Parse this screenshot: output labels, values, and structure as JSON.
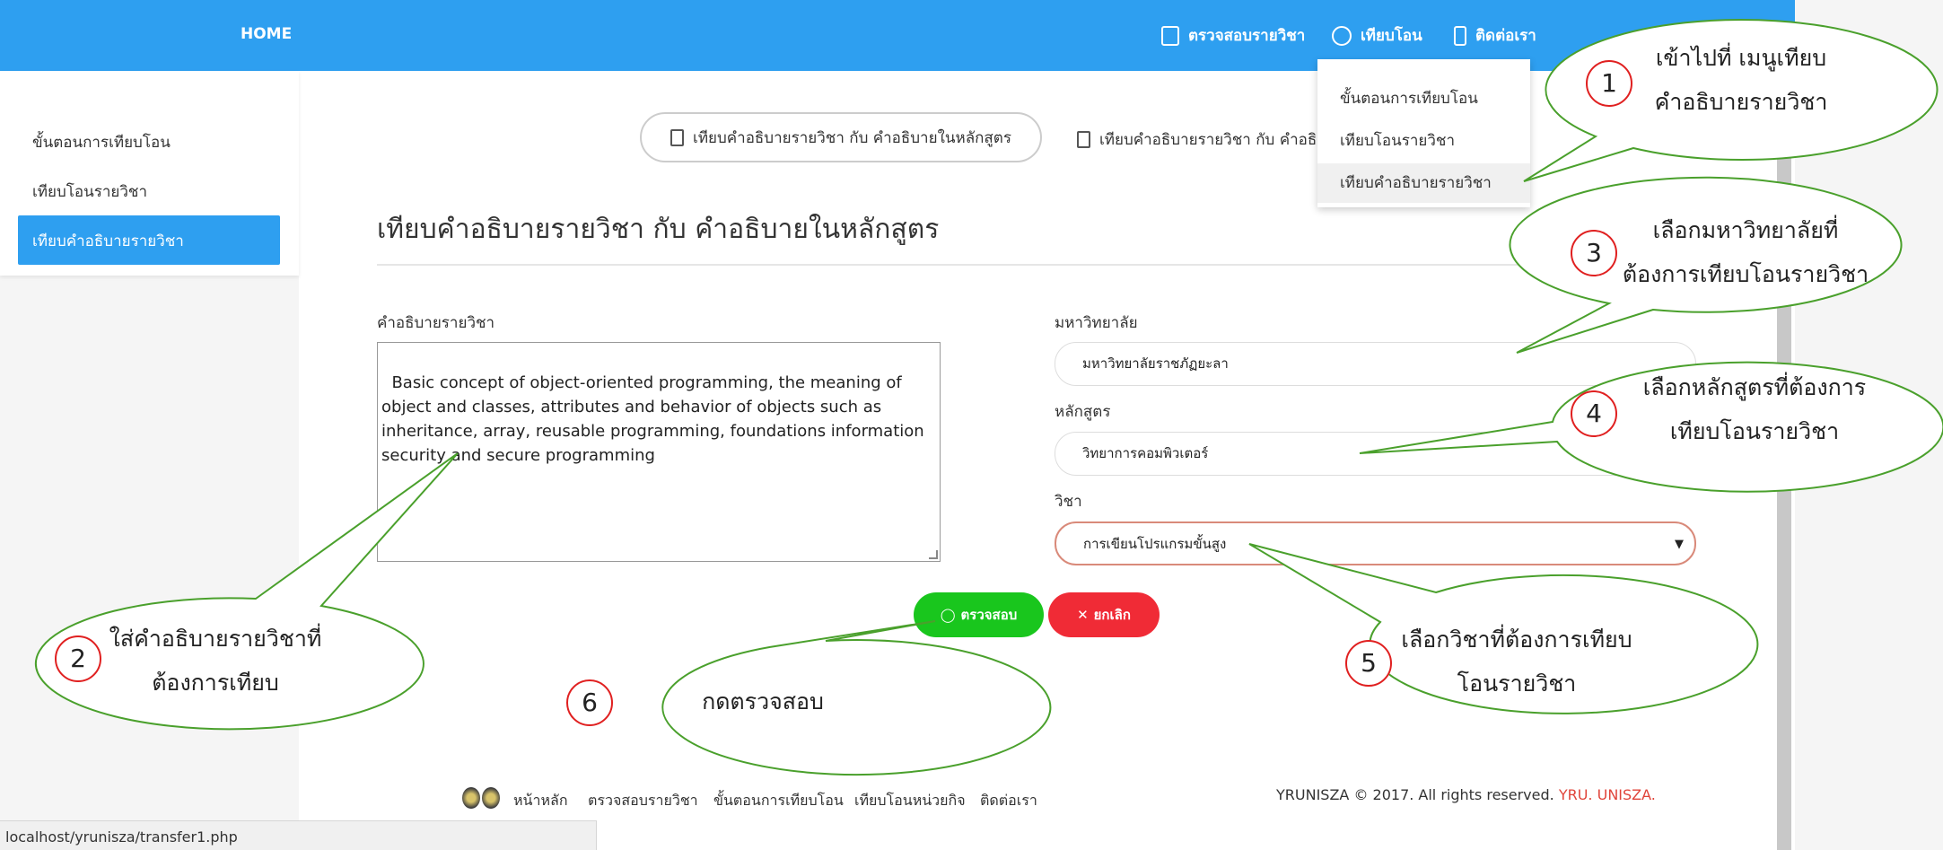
{
  "nav": {
    "brand": "HOME",
    "items": [
      {
        "label": "ตรวจสอบรายวิชา",
        "icon": "document-list-icon"
      },
      {
        "label": "เทียบโอน",
        "icon": "user-circle-icon"
      },
      {
        "label": "ติดต่อเรา",
        "icon": "phone-icon"
      }
    ],
    "dropdown": [
      "ขั้นตอนการเทียบโอน",
      "เทียบโอนรายวิชา",
      "เทียบคำอธิบายรายวิชา"
    ]
  },
  "sidebar": {
    "items": [
      "ขั้นตอนการเทียบโอน",
      "เทียบโอนรายวิชา",
      "เทียบคำอธิบายรายวิชา"
    ]
  },
  "tabs": [
    "เทียบคำอธิบายรายวิชา กับ คำอธิบายในหลักสูตร",
    "เทียบคำอธิบายรายวิชา กับ คำอธิ"
  ],
  "page": {
    "title": "เทียบคำอธิบายรายวิชา กับ คำอธิบายในหลักสูตร",
    "desc_label": "คำอธิบายรายวิชา",
    "desc_value": "Basic concept of object-oriented programming, the meaning of\nobject and classes, attributes and behavior of objects such as\ninheritance, array, reusable programming, foundations information\nsecurity and secure programming",
    "university_label": "มหาวิทยาลัย",
    "university_value": "มหาวิทยาลัยราชภัฏยะลา",
    "program_label": "หลักสูตร",
    "program_value": "วิทยาการคอมพิวเตอร์",
    "course_label": "วิชา",
    "course_value": "การเขียนโปรแกรมขั้นสูง",
    "check_button": "ตรวจสอบ",
    "cancel_button": "ยกเลิก"
  },
  "footer": {
    "links": [
      "หน้าหลัก",
      "ตรวจสอบรายวิชา",
      "ขั้นตอนการเทียบโอน",
      "เทียบโอนหน่วยกิจ",
      "ติดต่อเรา"
    ],
    "copyright": "YRUNISZA © 2017. All rights reserved.",
    "copyright_link": "YRU. UNISZA."
  },
  "status_url": "localhost/yrunisza/transfer1.php",
  "annotations": [
    {
      "num": "1",
      "lines": [
        "เข้าไปที่ เมนูเทียบ",
        "คำอธิบายรายวิชา"
      ]
    },
    {
      "num": "2",
      "lines": [
        "ใส่คำอธิบายรายวิชาที่",
        "ต้องการเทียบ"
      ]
    },
    {
      "num": "3",
      "lines": [
        "เลือกมหาวิทยาลัยที่",
        "ต้องการเทียบโอนรายวิชา"
      ]
    },
    {
      "num": "4",
      "lines": [
        "เลือกหลักสูตรที่ต้องการ",
        "เทียบโอนรายวิชา"
      ]
    },
    {
      "num": "5",
      "lines": [
        "เลือกวิชาที่ต้องการเทียบ",
        "โอนรายวิชา"
      ]
    },
    {
      "num": "6",
      "lines": [
        "กดตรวจสอบ"
      ]
    }
  ],
  "colors": {
    "nav": "#2e9ff0",
    "ok": "#19c61d",
    "cancel": "#f02b36",
    "annotation_stroke": "#4aa02c"
  }
}
